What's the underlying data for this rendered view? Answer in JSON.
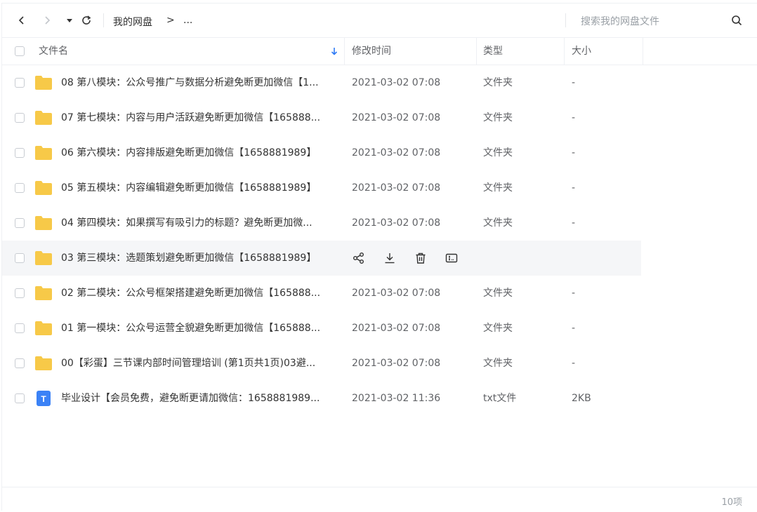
{
  "toolbar": {
    "breadcrumb_root": "我的网盘",
    "breadcrumb_sep": ">",
    "breadcrumb_more": "...",
    "search_placeholder": "搜索我的网盘文件"
  },
  "header": {
    "name": "文件名",
    "modified": "修改时间",
    "type": "类型",
    "size": "大小"
  },
  "rows": [
    {
      "name": "08 第八模块：公众号推广与数据分析避免断更加微信【1...",
      "date": "2021-03-02 07:08",
      "type": "文件夹",
      "size": "-",
      "icon": "folder-icon"
    },
    {
      "name": "07 第七模块：内容与用户活跃避免断更加微信【165888...",
      "date": "2021-03-02 07:08",
      "type": "文件夹",
      "size": "-",
      "icon": "folder-icon"
    },
    {
      "name": "06 第六模块：内容排版避免断更加微信【1658881989】",
      "date": "2021-03-02 07:08",
      "type": "文件夹",
      "size": "-",
      "icon": "folder-icon"
    },
    {
      "name": "05 第五模块：内容编辑避免断更加微信【1658881989】",
      "date": "2021-03-02 07:08",
      "type": "文件夹",
      "size": "-",
      "icon": "folder-icon"
    },
    {
      "name": "04 第四模块：如果撰写有吸引力的标题？避免断更加微...",
      "date": "2021-03-02 07:08",
      "type": "文件夹",
      "size": "-",
      "icon": "folder-icon"
    },
    {
      "name": "03 第三模块：选题策划避免断更加微信【1658881989】",
      "date": "",
      "type": "",
      "size": "",
      "icon": "folder-icon",
      "hover": true
    },
    {
      "name": "02 第二模块：公众号框架搭建避免断更加微信【165888...",
      "date": "2021-03-02 07:08",
      "type": "文件夹",
      "size": "-",
      "icon": "folder-icon"
    },
    {
      "name": "01 第一模块：公众号运营全貌避免断更加微信【165888...",
      "date": "2021-03-02 07:08",
      "type": "文件夹",
      "size": "-",
      "icon": "folder-icon"
    },
    {
      "name": "00【彩蛋】三节课内部时间管理培训 (第1页共1页)03避...",
      "date": "2021-03-02 07:08",
      "type": "文件夹",
      "size": "-",
      "icon": "folder-icon"
    },
    {
      "name": "毕业设计【会员免费，避免断更请加微信：1658881989...",
      "date": "2021-03-02 11:36",
      "type": "txt文件",
      "size": "2KB",
      "icon": "txt-file-icon",
      "icon_letter": "T"
    }
  ],
  "footer": {
    "count": "10项"
  },
  "colors": {
    "folder": "#f7c948",
    "txt": "#3b82f6",
    "accent": "#2f7bf5"
  }
}
